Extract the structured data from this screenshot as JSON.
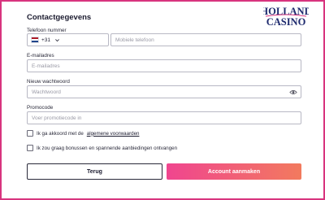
{
  "form": {
    "title": "Contactgegevens",
    "phone_label": "Telefoon nummer",
    "country_code": "+31",
    "phone_placeholder": "Mobiele telefoon",
    "email_label": "E-mailadres",
    "email_placeholder": "E-mailadres",
    "password_label": "Nieuw wachtwoord",
    "password_placeholder": "Wachtwoord",
    "promo_label": "Promocode",
    "promo_placeholder": "Voer promotiecode in",
    "terms_prefix": "Ik ga akkoord met de",
    "terms_link": "algemene voorwaarden",
    "bonus_label": "Ik zou graag bonussen en spannende aanbiedingen ontvangen"
  },
  "buttons": {
    "back": "Terug",
    "create": "Account aanmaken"
  },
  "logo": {
    "line1": "HOLLAND",
    "line2": "CASINO"
  },
  "colors": {
    "frame": "#d8347e",
    "button_gradient_start": "#f0458f",
    "button_gradient_end": "#f27a5e",
    "logo_blue": "#1e2a6e"
  },
  "icons": {
    "flag": "nl-flag-icon",
    "country_dropdown": "chevron-down-icon",
    "password_visibility": "eye-icon"
  }
}
